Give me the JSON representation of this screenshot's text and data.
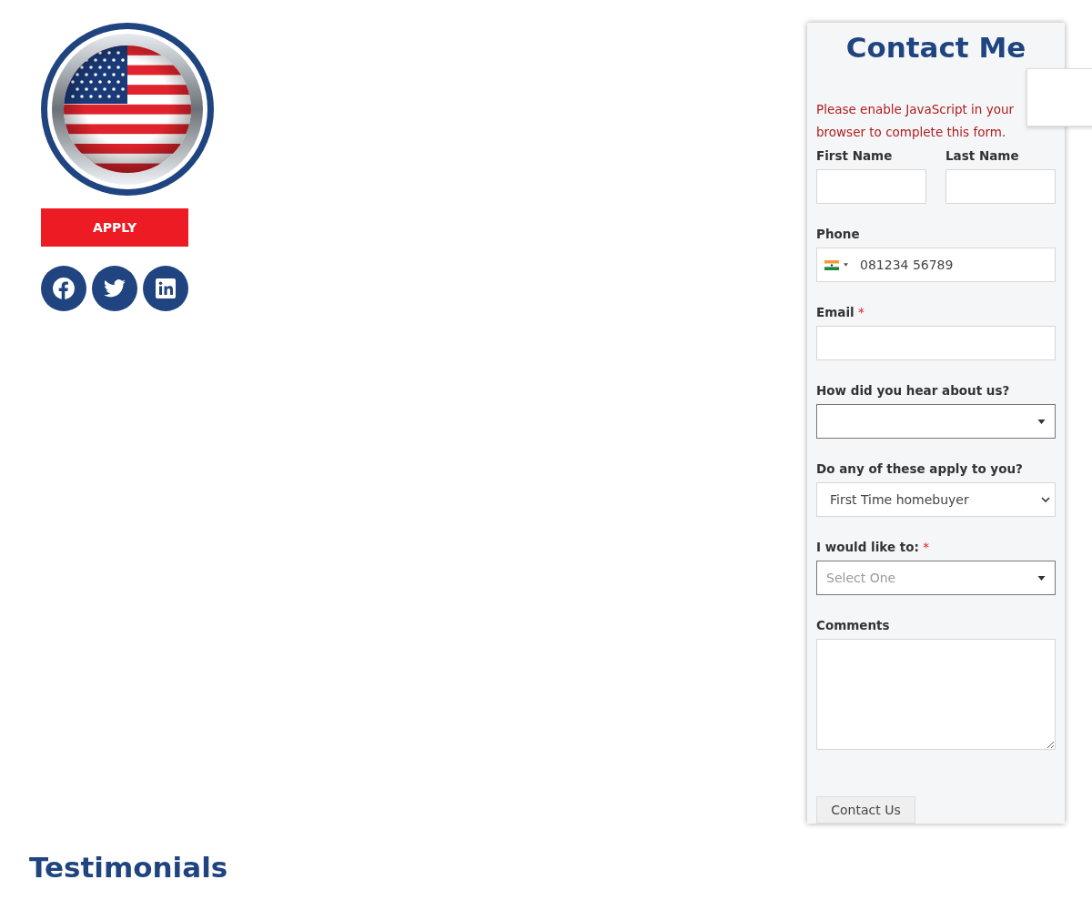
{
  "apply_button": "APPLY",
  "social_links": [
    {
      "kind": "facebook"
    },
    {
      "kind": "twitter"
    },
    {
      "kind": "linkedin"
    }
  ],
  "contact_form": {
    "title": "Contact Me",
    "notice": "Please enable JavaScript in your browser to complete this form.",
    "fields": [
      {
        "kind": "name_pair",
        "items": [
          {
            "label": "First Name"
          },
          {
            "label": "Last Name"
          }
        ]
      },
      {
        "kind": "phone",
        "label": "Phone",
        "value": "081234 56789"
      },
      {
        "kind": "text",
        "label": "Email",
        "required_mark": "*"
      },
      {
        "kind": "dropdown",
        "label": "How did you hear about us?"
      },
      {
        "kind": "select",
        "label": "Do any of these apply to you?",
        "value": "First Time homebuyer"
      },
      {
        "kind": "dropdown",
        "label": "I would like to:",
        "required_mark": "*",
        "placeholder": "Select One"
      },
      {
        "kind": "textarea",
        "label": "Comments"
      }
    ],
    "submit_button": "Contact Us"
  },
  "section_heading": "Testimonials"
}
